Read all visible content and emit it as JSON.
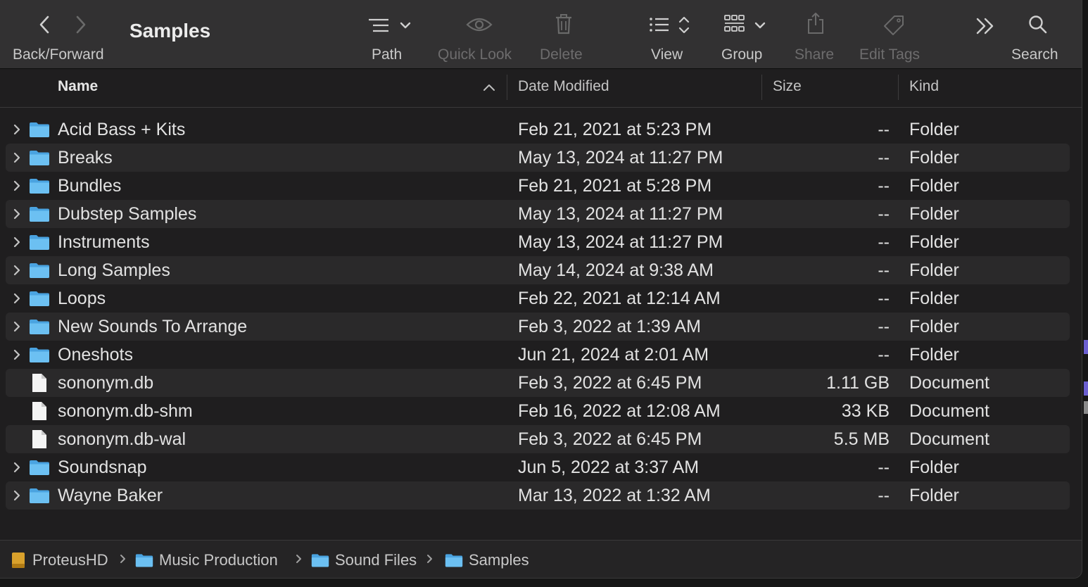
{
  "window": {
    "title": "Samples"
  },
  "toolbar": {
    "back_forward_label": "Back/Forward",
    "path_label": "Path",
    "quick_look_label": "Quick Look",
    "delete_label": "Delete",
    "view_label": "View",
    "group_label": "Group",
    "share_label": "Share",
    "edit_tags_label": "Edit Tags",
    "search_label": "Search",
    "icons": [
      "chevron-left-icon",
      "chevron-right-icon",
      "path-list-icon",
      "eye-icon",
      "trash-icon",
      "list-view-icon",
      "group-grid-icon",
      "share-icon",
      "tag-icon",
      "double-chevron-right-icon",
      "search-icon"
    ]
  },
  "columns": {
    "name": "Name",
    "date_modified": "Date Modified",
    "size": "Size",
    "kind": "Kind",
    "sort_indicator": "ascending"
  },
  "files": [
    {
      "name": "Acid Bass + Kits",
      "date": "Feb 21, 2021 at 5:23 PM",
      "size": "--",
      "kind": "Folder",
      "type": "folder"
    },
    {
      "name": "Breaks",
      "date": "May 13, 2024 at 11:27 PM",
      "size": "--",
      "kind": "Folder",
      "type": "folder"
    },
    {
      "name": "Bundles",
      "date": "Feb 21, 2021 at 5:28 PM",
      "size": "--",
      "kind": "Folder",
      "type": "folder"
    },
    {
      "name": "Dubstep Samples",
      "date": "May 13, 2024 at 11:27 PM",
      "size": "--",
      "kind": "Folder",
      "type": "folder"
    },
    {
      "name": "Instruments",
      "date": "May 13, 2024 at 11:27 PM",
      "size": "--",
      "kind": "Folder",
      "type": "folder"
    },
    {
      "name": "Long Samples",
      "date": "May 14, 2024 at 9:38 AM",
      "size": "--",
      "kind": "Folder",
      "type": "folder"
    },
    {
      "name": "Loops",
      "date": "Feb 22, 2021 at 12:14 AM",
      "size": "--",
      "kind": "Folder",
      "type": "folder"
    },
    {
      "name": "New Sounds To Arrange",
      "date": "Feb 3, 2022 at 1:39 AM",
      "size": "--",
      "kind": "Folder",
      "type": "folder"
    },
    {
      "name": "Oneshots",
      "date": "Jun 21, 2024 at 2:01 AM",
      "size": "--",
      "kind": "Folder",
      "type": "folder"
    },
    {
      "name": "sononym.db",
      "date": "Feb 3, 2022 at 6:45 PM",
      "size": "1.11 GB",
      "kind": "Document",
      "type": "document"
    },
    {
      "name": "sononym.db-shm",
      "date": "Feb 16, 2022 at 12:08 AM",
      "size": "33 KB",
      "kind": "Document",
      "type": "document"
    },
    {
      "name": "sononym.db-wal",
      "date": "Feb 3, 2022 at 6:45 PM",
      "size": "5.5 MB",
      "kind": "Document",
      "type": "document"
    },
    {
      "name": "Soundsnap",
      "date": "Jun 5, 2022 at 3:37 AM",
      "size": "--",
      "kind": "Folder",
      "type": "folder"
    },
    {
      "name": "Wayne Baker",
      "date": "Mar 13, 2022 at 1:32 AM",
      "size": "--",
      "kind": "Folder",
      "type": "folder"
    }
  ],
  "path_bar": [
    {
      "label": "ProteusHD",
      "icon": "drive-icon"
    },
    {
      "label": "Music Production",
      "icon": "folder-icon"
    },
    {
      "label": "Sound Files",
      "icon": "folder-icon"
    },
    {
      "label": "Samples",
      "icon": "folder-icon"
    }
  ],
  "colors": {
    "folder": "#5ab2ea",
    "accent": "#6b5fd0",
    "toolbar_bg": "#323132",
    "window_bg": "#1f1e1f",
    "alt_row": "#2a292a"
  }
}
